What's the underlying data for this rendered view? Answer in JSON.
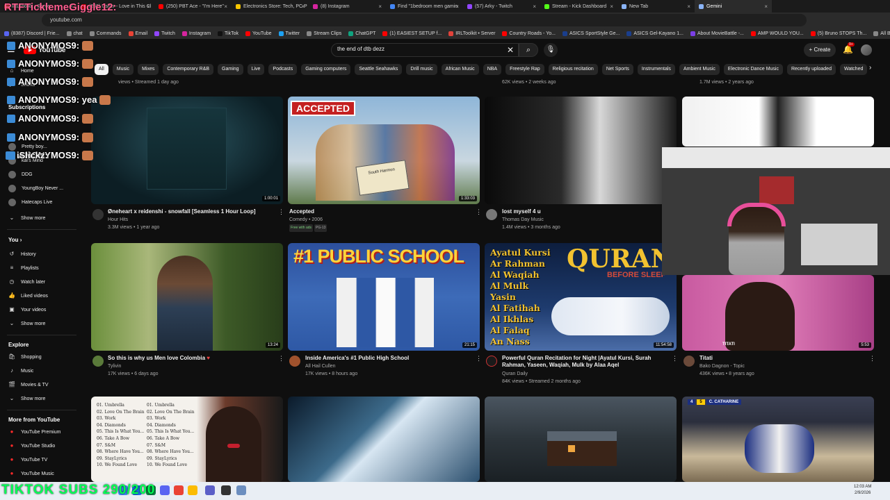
{
  "browser": {
    "tabs": [
      {
        "label": "IRLToolkit • Server",
        "color": "#e0423a"
      },
      {
        "label": "(250) Usher - Love in This Cl",
        "color": "#ff0000"
      },
      {
        "label": "(250) PBT Ace - \"I'm Here\"",
        "color": "#ff0000"
      },
      {
        "label": "Electronics Store: Tech, PC P",
        "color": "#f7c600"
      },
      {
        "label": "(8) Instagram",
        "color": "#d6249f"
      },
      {
        "label": "Find \"1bedroom men gamin",
        "color": "#4285f4"
      },
      {
        "label": "(57) Arky - Twitch",
        "color": "#9146ff"
      },
      {
        "label": "Stream - Kick Dashboard",
        "color": "#53fc18"
      },
      {
        "label": "New Tab",
        "color": "#8ab4f8"
      },
      {
        "label": "Gemini",
        "color": "#8ab4f8"
      }
    ],
    "url": "youtube.com",
    "bookmarks": [
      {
        "label": "(8387) Discord | Frie...",
        "color": "#5865f2"
      },
      {
        "label": "chat",
        "color": "#888"
      },
      {
        "label": "Commands",
        "color": "#888"
      },
      {
        "label": "Email",
        "color": "#ea4335"
      },
      {
        "label": "Twitch",
        "color": "#9146ff"
      },
      {
        "label": "Instagram",
        "color": "#d6249f"
      },
      {
        "label": "TikTok",
        "color": "#111"
      },
      {
        "label": "YouTube",
        "color": "#ff0000"
      },
      {
        "label": "Twitter",
        "color": "#1da1f2"
      },
      {
        "label": "Stream Clips",
        "color": "#888"
      },
      {
        "label": "ChatGPT",
        "color": "#10a37f"
      },
      {
        "label": "(1) EASIEST SETUP f...",
        "color": "#ff0000"
      },
      {
        "label": "IRLToolkit • Server",
        "color": "#e0423a"
      },
      {
        "label": "Country Roads - Yo...",
        "color": "#ff0000"
      },
      {
        "label": "ASICS SportStyle Ge...",
        "color": "#1a3e8c"
      },
      {
        "label": "ASICS Gel-Kayano 1...",
        "color": "#1a3e8c"
      },
      {
        "label": "About MovieBattle -...",
        "color": "#7b3fe4"
      },
      {
        "label": "AMP WOULD YOU...",
        "color": "#ff0000"
      },
      {
        "label": "(5) Bruno STOPS Th...",
        "color": "#ff0000"
      },
      {
        "label": "All Bookmarks",
        "color": "#888"
      }
    ]
  },
  "youtube": {
    "logo_text": "YouTube",
    "search_value": "the end of dtb dezz",
    "create_label": "Create",
    "notif_badge": "9+",
    "chips": [
      "All",
      "Music",
      "Mixes",
      "Contemporary R&B",
      "Gaming",
      "Live",
      "Podcasts",
      "Gaming computers",
      "Seattle Seahawks",
      "Drill music",
      "African Music",
      "NBA",
      "Freestyle Rap",
      "Religious recitation",
      "Net Sports",
      "Instrumentals",
      "Ambient Music",
      "Electronic Dance Music",
      "Recently uploaded",
      "Watched"
    ]
  },
  "sidebar": {
    "home": "Home",
    "shorts": "Shorts",
    "subscriptions": "Subscriptions",
    "subs": [
      "Pretty boy...",
      "kai's Mind",
      "DDG",
      "YoungBoy Never ...",
      "Hatecaps Live"
    ],
    "show_more": "Show more",
    "you": "You",
    "you_items": [
      "History",
      "Playlists",
      "Watch later",
      "Liked videos",
      "Your videos"
    ],
    "explore": "Explore",
    "explore_items": [
      "Shopping",
      "Music",
      "Movies & TV"
    ],
    "more_from": "More from YouTube",
    "more_items": [
      "YouTube Premium",
      "YouTube Studio",
      "YouTube TV",
      "YouTube Music"
    ]
  },
  "top_row_meta": {
    "a": "views • Streamed 1 day ago",
    "b": "62K views • 2 weeks ago",
    "c": "1.7M views • 2 years ago"
  },
  "videos": [
    {
      "title": "Øneheart x reidenshi - snowfall [Seamless 1 Hour Loop]",
      "channel": "Hour Hits",
      "meta": "3.3M views • 1 year ago",
      "duration": "1:00:01"
    },
    {
      "title": "Accepted",
      "channel": "Comedy • 2006",
      "meta": "",
      "duration": "1:33:03",
      "thumb_text": "ACCEPTED",
      "pill1": "Free with ads",
      "pill2": "PG-13"
    },
    {
      "title": "lost myself 4 u",
      "channel": "Thomas Day Music",
      "meta": "1.4M views • 3 months ago",
      "duration": ""
    },
    {
      "title": "So this is why us Men love Colombia",
      "channel": "Tylivin",
      "meta": "17K views • 6 days ago",
      "duration": "13:24"
    },
    {
      "title": "Inside America's #1 Public High School",
      "channel": "All Hail Cullen",
      "meta": "17K views • 8 hours ago",
      "duration": "21:15",
      "thumb_text": "#1 PUBLIC SCHOOL"
    },
    {
      "title": "Powerful Quran Recitation for Night |Ayatul Kursi, Surah Rahman, Yaseen, Waqiah, Mulk by Alaa Aqel",
      "channel": "Quran Daily",
      "meta": "84K views • Streamed 2 months ago",
      "duration": "11:54:58",
      "thumb_lines": [
        "Ayatul Kursi",
        "Ar Rahman",
        "Al Waqiah",
        "Al Mulk",
        "Yasin",
        "Al Fatihah",
        "Al Ikhlas",
        "Al Falaq",
        "An Nass"
      ],
      "thumb_big": "QURAN",
      "thumb_sub": "BEFORE SLEEP"
    },
    {
      "title": "Titati",
      "channel": "Bako Dagnon - Topic",
      "meta": "436K views • 8 years ago",
      "duration": "5:53",
      "thumb_text": "TITATI"
    }
  ],
  "row3_tracklist": [
    "01. Umbrella",
    "02. Love On The Brain",
    "03. Work",
    "04. Diamonds",
    "05. This Is What You...",
    "06. Take A Bow",
    "07. S&M",
    "08. Where Have You...",
    "09. StayLyrics",
    "10. We Found Love"
  ],
  "row3_score": {
    "left": "4",
    "right": "5",
    "right_team": "C. CATHARINE"
  },
  "overlay": {
    "top_name": "RTFTicklemeGiggle12:",
    "chat_lines": [
      "ANONYMOS9:",
      "ANONYMOS9:",
      "ANONYMOS9:",
      "ANONYMOS9: yea",
      "ANONYMOS9:",
      "ANONYMOS9:",
      "ANONYMOS9:",
      "iSlickz:"
    ],
    "marquee": "TIKTOK SUBS 290/200"
  },
  "clock": {
    "time": "12:03 AM",
    "date": "2/9/2026"
  }
}
